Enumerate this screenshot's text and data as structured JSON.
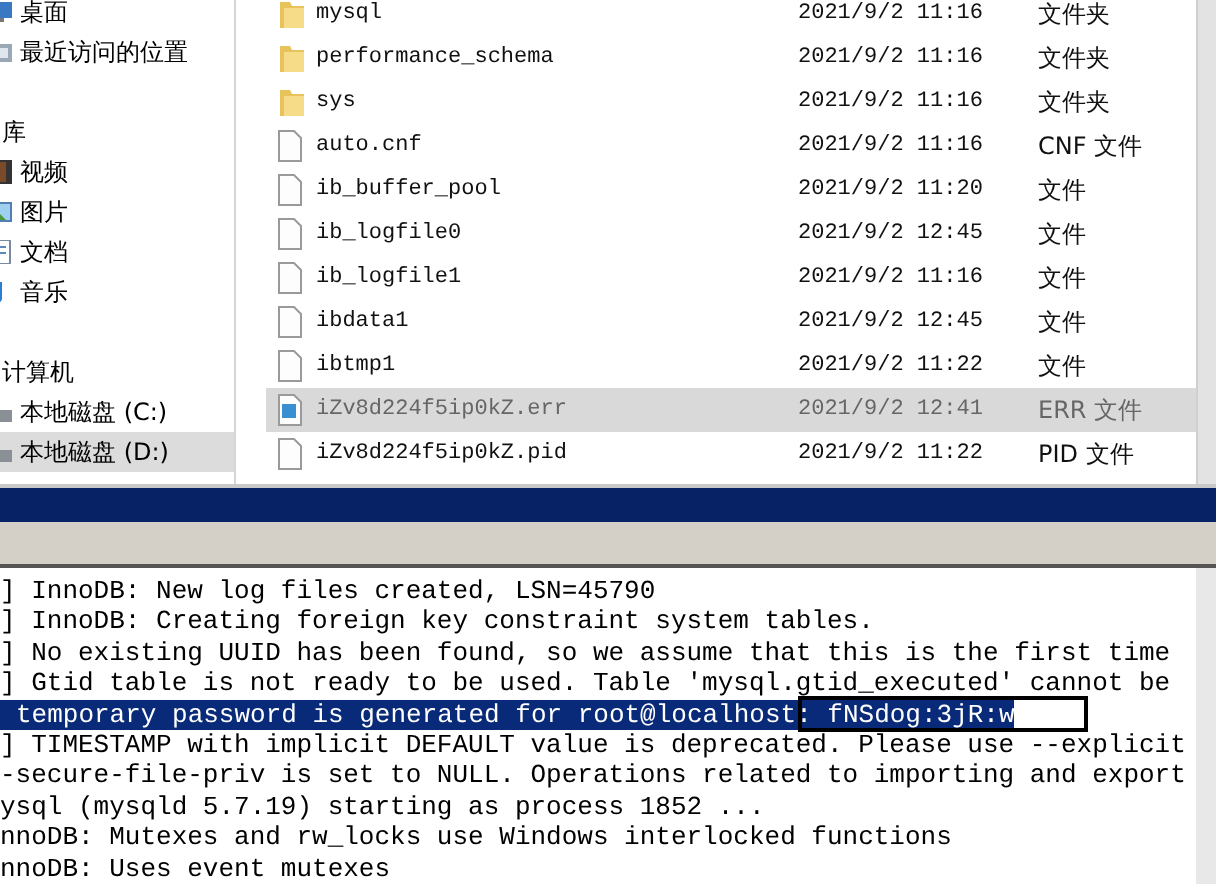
{
  "sidebar": {
    "items": [
      {
        "label": "桌面",
        "selected": false,
        "kind": "item"
      },
      {
        "label": "最近访问的位置",
        "selected": false,
        "kind": "item"
      },
      {
        "kind": "gap"
      },
      {
        "label": "库",
        "kind": "group"
      },
      {
        "label": "视频",
        "selected": false,
        "kind": "item"
      },
      {
        "label": "图片",
        "selected": false,
        "kind": "item"
      },
      {
        "label": "文档",
        "selected": false,
        "kind": "item"
      },
      {
        "label": "音乐",
        "selected": false,
        "kind": "item"
      },
      {
        "kind": "gap"
      },
      {
        "label": "计算机",
        "kind": "group"
      },
      {
        "label": "本地磁盘 (C:)",
        "selected": false,
        "kind": "item"
      },
      {
        "label": "本地磁盘 (D:)",
        "selected": true,
        "kind": "item"
      }
    ]
  },
  "files": [
    {
      "name": "mysql",
      "date": "2021/9/2 11:16",
      "type": "文件夹",
      "kind": "folder",
      "selected": false
    },
    {
      "name": "performance_schema",
      "date": "2021/9/2 11:16",
      "type": "文件夹",
      "kind": "folder",
      "selected": false
    },
    {
      "name": "sys",
      "date": "2021/9/2 11:16",
      "type": "文件夹",
      "kind": "folder",
      "selected": false
    },
    {
      "name": "auto.cnf",
      "date": "2021/9/2 11:16",
      "type": "CNF 文件",
      "kind": "file",
      "selected": false
    },
    {
      "name": "ib_buffer_pool",
      "date": "2021/9/2 11:20",
      "type": "文件",
      "kind": "file",
      "selected": false
    },
    {
      "name": "ib_logfile0",
      "date": "2021/9/2 12:45",
      "type": "文件",
      "kind": "file",
      "selected": false
    },
    {
      "name": "ib_logfile1",
      "date": "2021/9/2 11:16",
      "type": "文件",
      "kind": "file",
      "selected": false
    },
    {
      "name": "ibdata1",
      "date": "2021/9/2 12:45",
      "type": "文件",
      "kind": "file",
      "selected": false
    },
    {
      "name": "ibtmp1",
      "date": "2021/9/2 11:22",
      "type": "文件",
      "kind": "file",
      "selected": false
    },
    {
      "name": "iZv8d224f5ip0kZ.err",
      "date": "2021/9/2 12:41",
      "type": "ERR 文件",
      "kind": "log",
      "selected": true
    },
    {
      "name": "iZv8d224f5ip0kZ.pid",
      "date": "2021/9/2 11:22",
      "type": "PID 文件",
      "kind": "file",
      "selected": false
    }
  ],
  "console": {
    "lines": [
      {
        "text": "] InnoDB: New log files created, LSN=45790",
        "selected": false
      },
      {
        "text": "] InnoDB: Creating foreign key constraint system tables.",
        "selected": false
      },
      {
        "text": "] No existing UUID has been found, so we assume that this is the first time",
        "selected": false
      },
      {
        "text": "] Gtid table is not ready to be used. Table 'mysql.gtid_executed' cannot be",
        "selected": false
      },
      {
        "text": "temporary password is generated for root@localhost: fNSdog:3jR:w",
        "selected": true
      },
      {
        "text": "] TIMESTAMP with implicit DEFAULT value is deprecated. Please use --explicit",
        "selected": false
      },
      {
        "text": "-secure-file-priv is set to NULL. Operations related to importing and export",
        "selected": false
      },
      {
        "text": "ysql (mysqld 5.7.19) starting as process 1852 ...",
        "selected": false
      },
      {
        "text": "nnoDB: Mutexes and rw_locks use Windows interlocked functions",
        "selected": false
      },
      {
        "text": "nnoDB: Uses event mutexes",
        "selected": false
      }
    ]
  }
}
